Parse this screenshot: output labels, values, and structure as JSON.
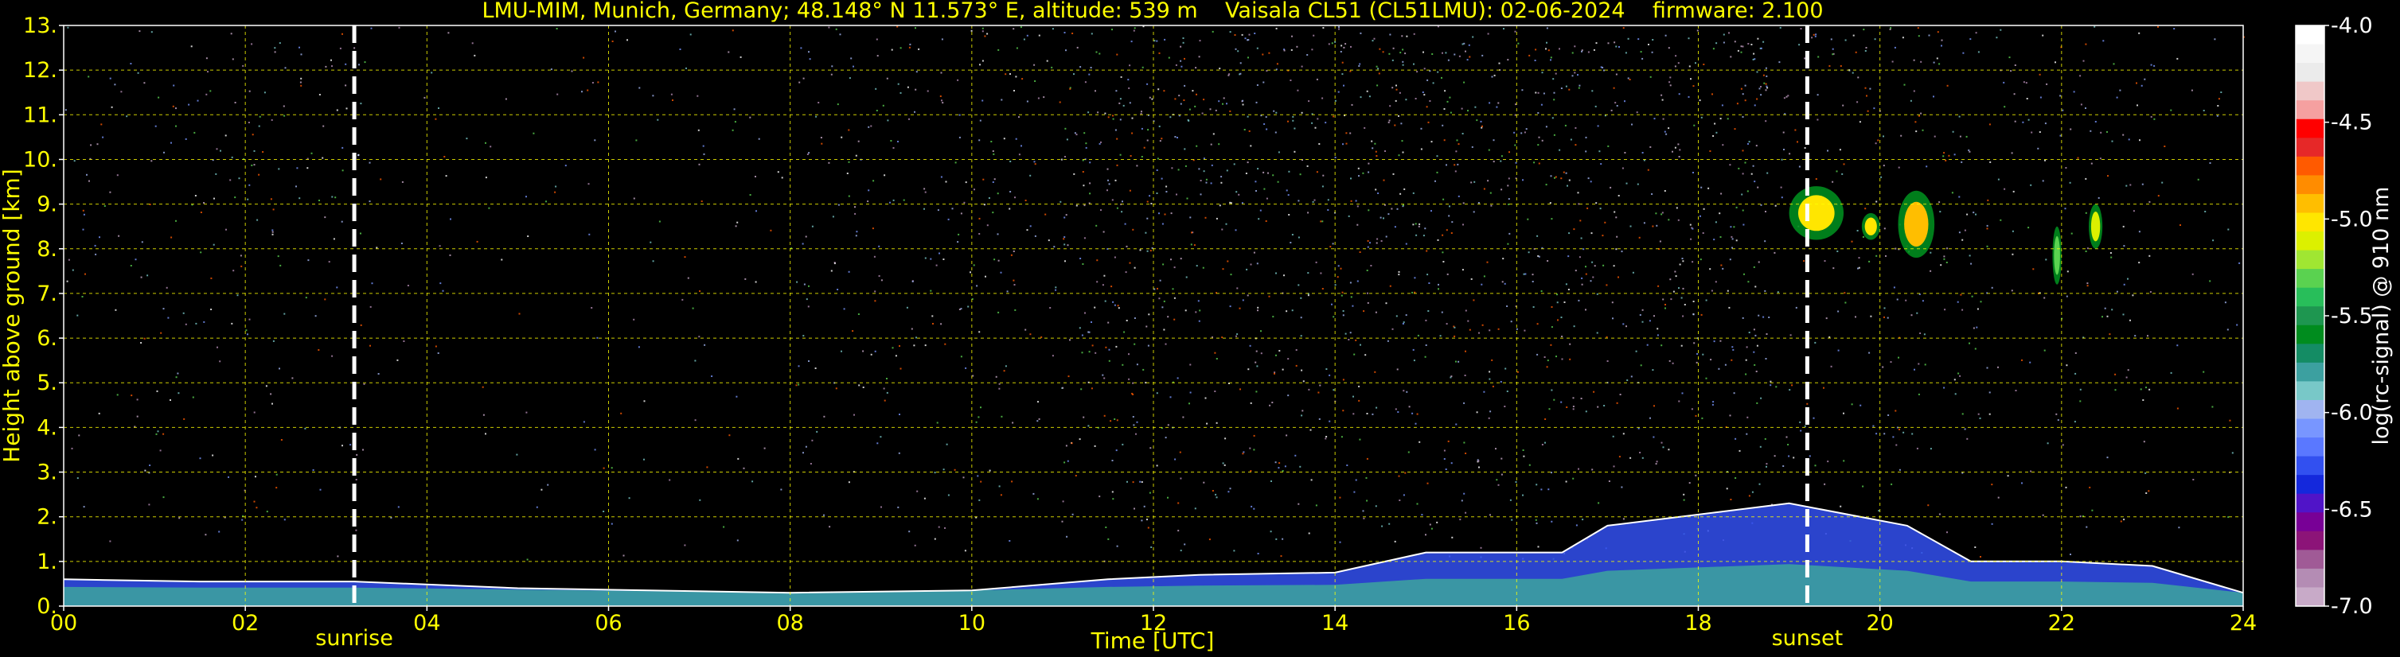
{
  "chart_data": {
    "type": "heatmap",
    "title": "LMU-MIM, Munich, Germany; 48.148° N 11.573° E, altitude: 539 m    Vaisala CL51 (CL51LMU): 02-06-2024    firmware: 2.100",
    "xlabel": "Time [UTC]",
    "ylabel": "Height above ground [km]",
    "xlim": [
      0,
      24
    ],
    "ylim": [
      0,
      13
    ],
    "x_ticks": [
      "00",
      "02",
      "04",
      "06",
      "08",
      "10",
      "12",
      "14",
      "16",
      "18",
      "20",
      "22",
      "24"
    ],
    "y_ticks": [
      "0.",
      "1.",
      "2.",
      "3.",
      "4.",
      "5.",
      "6.",
      "7.",
      "8.",
      "9.",
      "10.",
      "11.",
      "12.",
      "13."
    ],
    "grid": true,
    "grid_color": "#ffff00",
    "background": "#000000",
    "markers": [
      {
        "label": "sunrise",
        "x": 3.2
      },
      {
        "label": "sunset",
        "x": 19.2
      }
    ],
    "colorbar": {
      "label": "log(rc-signal) @ 910 nm",
      "range": [
        -7.0,
        -4.0
      ],
      "ticks": [
        "-4.0",
        "-4.5",
        "-5.0",
        "-5.5",
        "-6.0",
        "-6.5",
        "-7.0"
      ],
      "tick_values": [
        -4.0,
        -4.5,
        -5.0,
        -5.5,
        -6.0,
        -6.5,
        -7.0
      ],
      "colors": [
        "#ffffff",
        "#f5f5f5",
        "#ebebeb",
        "#f0c8c8",
        "#f5a0a0",
        "#ff0000",
        "#e62828",
        "#ff5a00",
        "#ff8c00",
        "#ffbe00",
        "#ffe600",
        "#dcf000",
        "#a0e632",
        "#5ad250",
        "#28be5a",
        "#1e9650",
        "#008c1e",
        "#148c64",
        "#3ca0a0",
        "#78c8c8",
        "#a0b4f0",
        "#7896ff",
        "#5a78ff",
        "#3250f0",
        "#1428dc",
        "#5014c8",
        "#780096",
        "#8c1478",
        "#a05a96",
        "#b48cb4",
        "#c8aac8"
      ]
    },
    "boundary_layer_top_km": [
      {
        "t": 0.0,
        "h": 0.6
      },
      {
        "t": 1.5,
        "h": 0.55
      },
      {
        "t": 3.2,
        "h": 0.55
      },
      {
        "t": 5.0,
        "h": 0.4
      },
      {
        "t": 8.0,
        "h": 0.3
      },
      {
        "t": 10.0,
        "h": 0.35
      },
      {
        "t": 11.5,
        "h": 0.6
      },
      {
        "t": 12.5,
        "h": 0.7
      },
      {
        "t": 14.0,
        "h": 0.75
      },
      {
        "t": 15.0,
        "h": 1.2
      },
      {
        "t": 16.5,
        "h": 1.2
      },
      {
        "t": 17.0,
        "h": 1.8
      },
      {
        "t": 19.0,
        "h": 2.3
      },
      {
        "t": 20.3,
        "h": 1.8
      },
      {
        "t": 21.0,
        "h": 1.0
      },
      {
        "t": 22.0,
        "h": 1.0
      },
      {
        "t": 23.0,
        "h": 0.9
      },
      {
        "t": 24.0,
        "h": 0.3
      }
    ],
    "cloud_layers": [
      {
        "t0": 19.0,
        "t1": 19.6,
        "h0": 8.2,
        "h1": 9.4,
        "intensity": "-5.0"
      },
      {
        "t0": 19.8,
        "t1": 20.0,
        "h0": 8.2,
        "h1": 8.8,
        "intensity": "-5.0"
      },
      {
        "t0": 20.2,
        "t1": 20.6,
        "h0": 7.8,
        "h1": 9.3,
        "intensity": "-4.9"
      },
      {
        "t0": 21.9,
        "t1": 22.0,
        "h0": 7.2,
        "h1": 8.5,
        "intensity": "-5.3"
      },
      {
        "t0": 22.3,
        "t1": 22.45,
        "h0": 8.0,
        "h1": 9.0,
        "intensity": "-5.1"
      }
    ]
  }
}
